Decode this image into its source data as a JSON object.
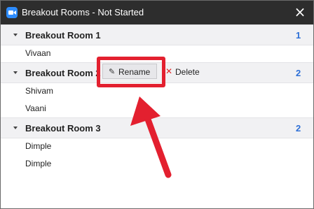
{
  "window": {
    "title": "Breakout Rooms - Not Started"
  },
  "rooms": [
    {
      "name": "Breakout Room 1",
      "count": "1",
      "members": [
        "Vivaan"
      ]
    },
    {
      "name": "Breakout Room 2",
      "count": "2",
      "members": [
        "Shivam",
        "Vaani"
      ]
    },
    {
      "name": "Breakout Room 3",
      "count": "2",
      "members": [
        "Dimple",
        "Dimple"
      ]
    }
  ],
  "actions": {
    "rename_label": "Rename",
    "delete_label": "Delete"
  },
  "icons": {
    "close": "close-icon",
    "app": "zoom-camera-icon",
    "pencil": "pencil-icon",
    "delete": "x-icon",
    "caret": "caret-down-icon"
  },
  "colors": {
    "accent": "#2d6fd6",
    "highlight": "#e3202f",
    "titlebar": "#2d2d2d"
  }
}
